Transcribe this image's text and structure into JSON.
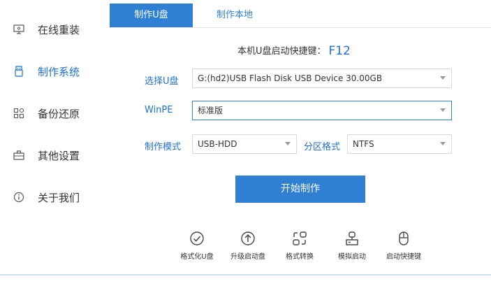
{
  "sidebar": {
    "items": [
      {
        "label": "在线重装",
        "icon": "monitor-icon"
      },
      {
        "label": "制作系统",
        "icon": "usb-drive-icon"
      },
      {
        "label": "备份还原",
        "icon": "grid-icon"
      },
      {
        "label": "其他设置",
        "icon": "toolbox-icon"
      },
      {
        "label": "关于我们",
        "icon": "info-icon"
      }
    ],
    "active_index": 1
  },
  "tabs": [
    {
      "label": "制作U盘"
    },
    {
      "label": "制作本地"
    }
  ],
  "hotkey": {
    "text": "本机U盘启动快捷键：",
    "key": "F12"
  },
  "form": {
    "usb": {
      "label": "选择U盘",
      "value": "G:(hd2)USB Flash Disk USB Device 30.00GB"
    },
    "winpe": {
      "label": "WinPE",
      "value": "标准版"
    },
    "mode": {
      "label": "制作模式",
      "value": "USB-HDD"
    },
    "partition": {
      "label": "分区格式",
      "value": "NTFS"
    }
  },
  "start_button": "开始制作",
  "tools": [
    {
      "label": "格式化U盘",
      "icon": "check-circle-icon"
    },
    {
      "label": "升级启动盘",
      "icon": "upgrade-arrow-icon"
    },
    {
      "label": "格式转换",
      "icon": "convert-icon"
    },
    {
      "label": "模拟启动",
      "icon": "simulate-boot-icon"
    },
    {
      "label": "启动快捷键",
      "icon": "mouse-icon"
    }
  ],
  "colors": {
    "accent": "#2f7fd3",
    "active_text": "#1f6fd1"
  }
}
